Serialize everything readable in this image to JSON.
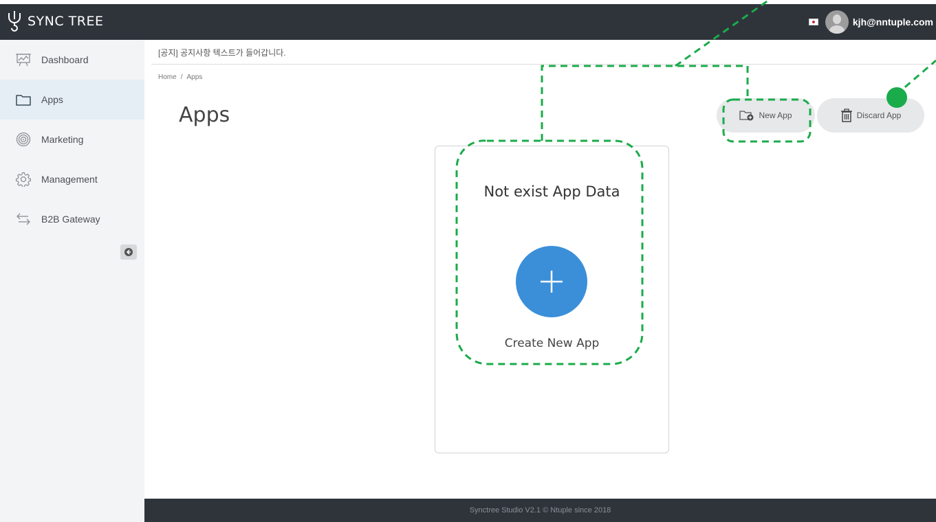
{
  "header": {
    "app_name": "SYNC TREE",
    "user_email": "kjh@nntuple.com",
    "logo_icon": "synctree-logo-icon",
    "flag_icon": "korea-flag-icon"
  },
  "sidebar": {
    "items": [
      {
        "label": "Dashboard",
        "icon": "dashboard-icon",
        "active": false
      },
      {
        "label": "Apps",
        "icon": "folder-icon",
        "active": true
      },
      {
        "label": "Marketing",
        "icon": "target-icon",
        "active": false
      },
      {
        "label": "Management",
        "icon": "gear-icon",
        "active": false
      },
      {
        "label": "B2B Gateway",
        "icon": "swap-arrows-icon",
        "active": false
      }
    ],
    "collapse_icon": "arrow-left-circle-icon"
  },
  "main": {
    "notice": "[공지] 공지사항 텍스트가 들어갑니다.",
    "breadcrumb": {
      "home": "Home",
      "separator": "/",
      "current": "Apps"
    },
    "title": "Apps",
    "buttons": {
      "new_app": "New App",
      "discard_app": "Discard App"
    },
    "empty_card": {
      "message": "Not exist App Data",
      "create_label": "Create New App"
    }
  },
  "footer": {
    "text": "Synctree Studio V2.1 © Ntuple since 2018"
  },
  "colors": {
    "header_bg": "#2f343b",
    "sidebar_bg": "#f3f4f5",
    "active_item_bg": "#e4eef4",
    "accent_blue": "#3b8fd9",
    "annotation_green": "#1aab4a"
  }
}
